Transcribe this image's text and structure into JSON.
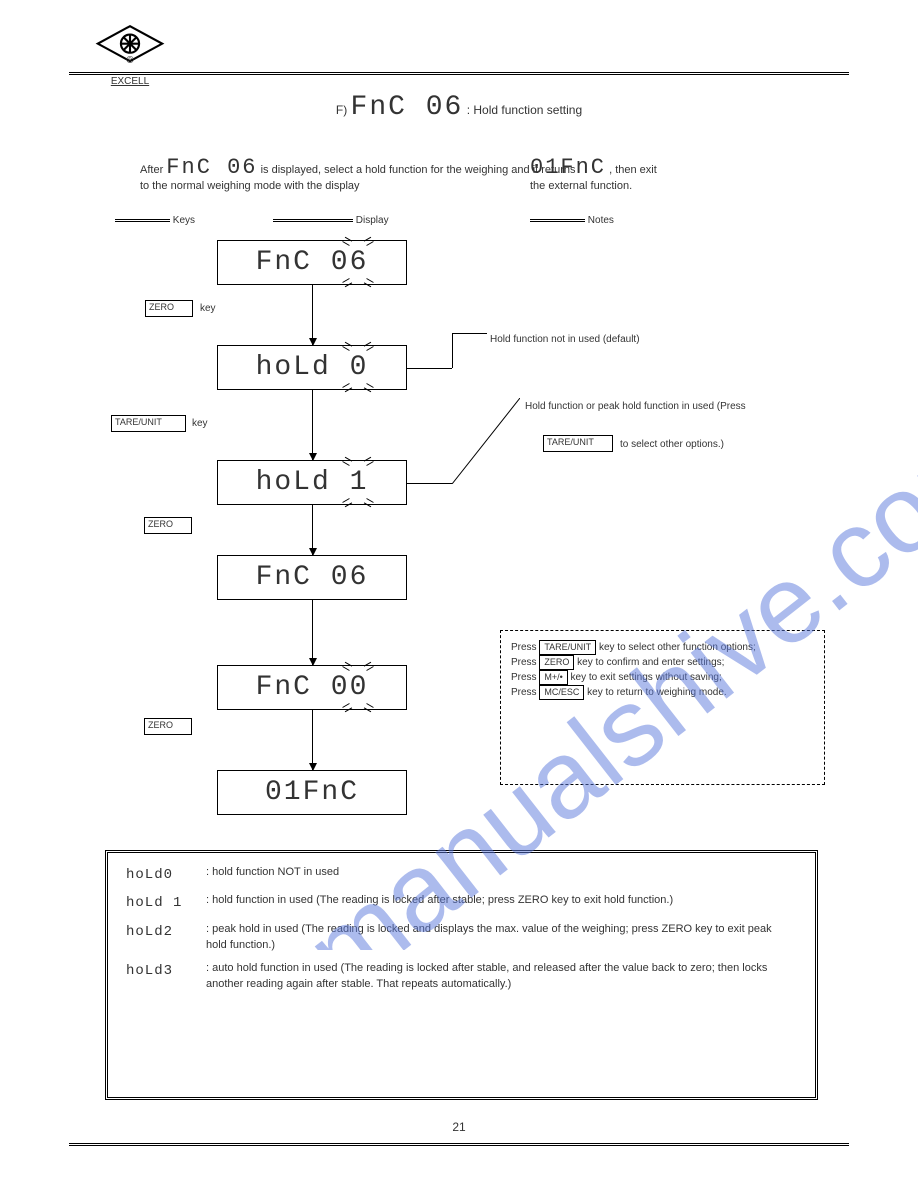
{
  "logo_text": "EXCELL",
  "title_pre": "F)",
  "title_seg": "FnC 06",
  "title_post": " : Hold function setting",
  "sub_left_1": "After ",
  "sub_left_seg": "FnC 06",
  "sub_left_2": " is displayed, select a hold function for the weighing and it returns",
  "sub_left_3": "to the normal weighing mode with the display ",
  "sub_right_seg": "01FnC",
  "sub_right_2": ", then exit",
  "sub_left_4": "the external function.",
  "col1": "Keys",
  "col2": "Display",
  "col3": "Notes",
  "kb1": "ZERO",
  "kb2": "TARE/UNIT",
  "kb3": "ZERO",
  "kb4": "ZERO",
  "kr1": "key",
  "kr2": "key",
  "fb1": "FnC 06",
  "fb2": "hoLd 0",
  "fb3": "hoLd 1",
  "fb4": "FnC 06",
  "fb5": "FnC 00",
  "fb6": "01FnC",
  "ann1": "Hold function not in used (default)",
  "ann2": "Hold function or peak hold function in used (Press",
  "kbox_r": "TARE/UNIT",
  "ann3": "to select other options.)",
  "note": {
    "line1_a": "Press ",
    "line1_key": "TARE/UNIT",
    "line1_b": " key to select other function options;",
    "line2_a": "Press ",
    "line2_key": "ZERO",
    "line2_b": " key to confirm and enter settings;",
    "line3_a": "Press ",
    "line3_key": "M+/•",
    "line3_b": " key to exit settings without saving;",
    "line4_a": "Press ",
    "line4_key": "MC/ESC",
    "line4_b": " key to return to weighing mode."
  },
  "desc": {
    "r1_code": "hoLd0",
    "r1_txt": ": hold function NOT in used",
    "r2_code": "hoLd 1",
    "r2_txt": ": hold function in used (The reading is locked after stable; press ZERO key to exit hold function.)",
    "r3_code": "hoLd2",
    "r3_txt": ": peak hold in used (The reading is locked and displays the max. value of the weighing; press ZERO key to exit peak hold function.)",
    "r4_code": "hoLd3",
    "r4_txt": ": auto hold function in used (The reading is locked after stable, and released after the value back to zero; then locks another reading again after stable. That repeats automatically.)"
  },
  "page_number": "21"
}
